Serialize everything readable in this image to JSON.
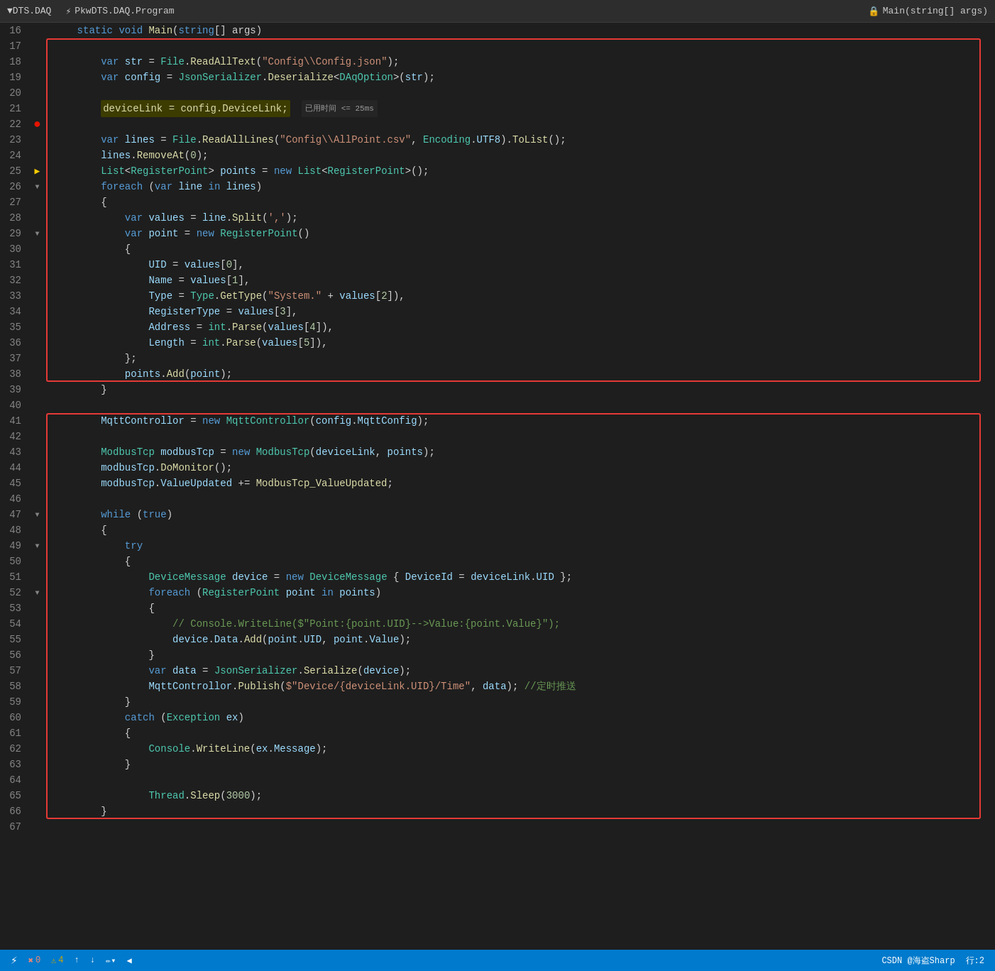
{
  "titleBar": {
    "left": "▼DTS.DAQ",
    "centerIcon": "⚡",
    "centerText": "PkwDTS.DAQ.Program",
    "rightIcon": "🔒",
    "rightText": "Main(string[] args)"
  },
  "statusBar": {
    "errors": "0",
    "warnings": "4",
    "upArrow": "↑",
    "downArrow": "↓",
    "editIcon": "✏",
    "leftArrow": "◀",
    "rightText": "CSDN @海盗Sharp",
    "lineCol": "行:2"
  },
  "lines": [
    {
      "num": 16,
      "indent": 1,
      "content": "static void Main(string[] args)",
      "type": "code"
    },
    {
      "num": 17,
      "indent": 0,
      "content": "",
      "type": "empty"
    },
    {
      "num": 18,
      "indent": 2,
      "content": "var str = File.ReadAllText(\"Config\\\\Config.json\");",
      "type": "code"
    },
    {
      "num": 19,
      "indent": 2,
      "content": "var config = JsonSerializer.Deserialize<DAqOption>(str);",
      "type": "code"
    },
    {
      "num": 20,
      "indent": 0,
      "content": "",
      "type": "empty"
    },
    {
      "num": 21,
      "indent": 2,
      "content": "deviceLink = config.DeviceLink;",
      "type": "code-hl",
      "badge": "已用时间 <= 25ms"
    },
    {
      "num": 22,
      "indent": 0,
      "content": "",
      "type": "empty",
      "breakpoint": true
    },
    {
      "num": 23,
      "indent": 2,
      "content": "var lines = File.ReadAllLines(\"Config\\\\AllPoint.csv\", Encoding.UTF8).ToList();",
      "type": "code"
    },
    {
      "num": 24,
      "indent": 2,
      "content": "lines.RemoveAt(0);",
      "type": "code"
    },
    {
      "num": 25,
      "indent": 2,
      "content": "List<RegisterPoint> points = new List<RegisterPoint>();",
      "type": "code",
      "arrow": true
    },
    {
      "num": 26,
      "indent": 2,
      "content": "foreach (var line in lines)",
      "type": "code",
      "fold": true
    },
    {
      "num": 27,
      "indent": 2,
      "content": "{",
      "type": "code"
    },
    {
      "num": 28,
      "indent": 3,
      "content": "var values = line.Split(',');",
      "type": "code"
    },
    {
      "num": 29,
      "indent": 3,
      "content": "var point = new RegisterPoint()",
      "type": "code",
      "fold": true
    },
    {
      "num": 30,
      "indent": 3,
      "content": "{",
      "type": "code"
    },
    {
      "num": 31,
      "indent": 4,
      "content": "UID = values[0],",
      "type": "code"
    },
    {
      "num": 32,
      "indent": 4,
      "content": "Name = values[1],",
      "type": "code"
    },
    {
      "num": 33,
      "indent": 4,
      "content": "Type = Type.GetType(\"System.\" + values[2]),",
      "type": "code"
    },
    {
      "num": 34,
      "indent": 4,
      "content": "RegisterType = values[3],",
      "type": "code"
    },
    {
      "num": 35,
      "indent": 4,
      "content": "Address = int.Parse(values[4]),",
      "type": "code"
    },
    {
      "num": 36,
      "indent": 4,
      "content": "Length = int.Parse(values[5]),",
      "type": "code"
    },
    {
      "num": 37,
      "indent": 3,
      "content": "};",
      "type": "code"
    },
    {
      "num": 38,
      "indent": 3,
      "content": "points.Add(point);",
      "type": "code"
    },
    {
      "num": 39,
      "indent": 2,
      "content": "}",
      "type": "code"
    },
    {
      "num": 40,
      "indent": 0,
      "content": "",
      "type": "empty"
    },
    {
      "num": 41,
      "indent": 2,
      "content": "MqttControllor = new MqttControllor(config.MqttConfig);",
      "type": "code"
    },
    {
      "num": 42,
      "indent": 0,
      "content": "",
      "type": "empty"
    },
    {
      "num": 43,
      "indent": 2,
      "content": "ModbusTcp modbusTcp = new ModbusTcp(deviceLink, points);",
      "type": "code"
    },
    {
      "num": 44,
      "indent": 2,
      "content": "modbusTcp.DoMonitor();",
      "type": "code"
    },
    {
      "num": 45,
      "indent": 2,
      "content": "modbusTcp.ValueUpdated += ModbusTcp_ValueUpdated;",
      "type": "code"
    },
    {
      "num": 46,
      "indent": 0,
      "content": "",
      "type": "empty"
    },
    {
      "num": 47,
      "indent": 2,
      "content": "while (true)",
      "type": "code",
      "fold": true
    },
    {
      "num": 48,
      "indent": 2,
      "content": "{",
      "type": "code"
    },
    {
      "num": 49,
      "indent": 3,
      "content": "try",
      "type": "code",
      "fold": true
    },
    {
      "num": 50,
      "indent": 3,
      "content": "{",
      "type": "code"
    },
    {
      "num": 51,
      "indent": 4,
      "content": "DeviceMessage device = new DeviceMessage { DeviceId = deviceLink.UID };",
      "type": "code"
    },
    {
      "num": 52,
      "indent": 4,
      "content": "foreach (RegisterPoint point in points)",
      "type": "code",
      "fold": true
    },
    {
      "num": 53,
      "indent": 4,
      "content": "{",
      "type": "code"
    },
    {
      "num": 54,
      "indent": 5,
      "content": "// Console.WriteLine($\"Point:{point.UID}-->Value:{point.Value}\");",
      "type": "comment"
    },
    {
      "num": 55,
      "indent": 5,
      "content": "device.Data.Add(point.UID, point.Value);",
      "type": "code"
    },
    {
      "num": 56,
      "indent": 4,
      "content": "}",
      "type": "code"
    },
    {
      "num": 57,
      "indent": 4,
      "content": "var data = JsonSerializer.Serialize(device);",
      "type": "code"
    },
    {
      "num": 58,
      "indent": 4,
      "content": "MqttControllor.Publish($\"Device/{deviceLink.UID}/Time\", data); //定时推送",
      "type": "code"
    },
    {
      "num": 59,
      "indent": 3,
      "content": "}",
      "type": "code"
    },
    {
      "num": 60,
      "indent": 3,
      "content": "catch (Exception ex)",
      "type": "code"
    },
    {
      "num": 61,
      "indent": 3,
      "content": "{",
      "type": "code"
    },
    {
      "num": 62,
      "indent": 4,
      "content": "Console.WriteLine(ex.Message);",
      "type": "code"
    },
    {
      "num": 63,
      "indent": 3,
      "content": "}",
      "type": "code"
    },
    {
      "num": 64,
      "indent": 0,
      "content": "",
      "type": "empty"
    },
    {
      "num": 65,
      "indent": 4,
      "content": "Thread.Sleep(3000);",
      "type": "code"
    },
    {
      "num": 66,
      "indent": 2,
      "content": "}",
      "type": "code"
    },
    {
      "num": 67,
      "indent": 0,
      "content": "",
      "type": "empty"
    }
  ]
}
